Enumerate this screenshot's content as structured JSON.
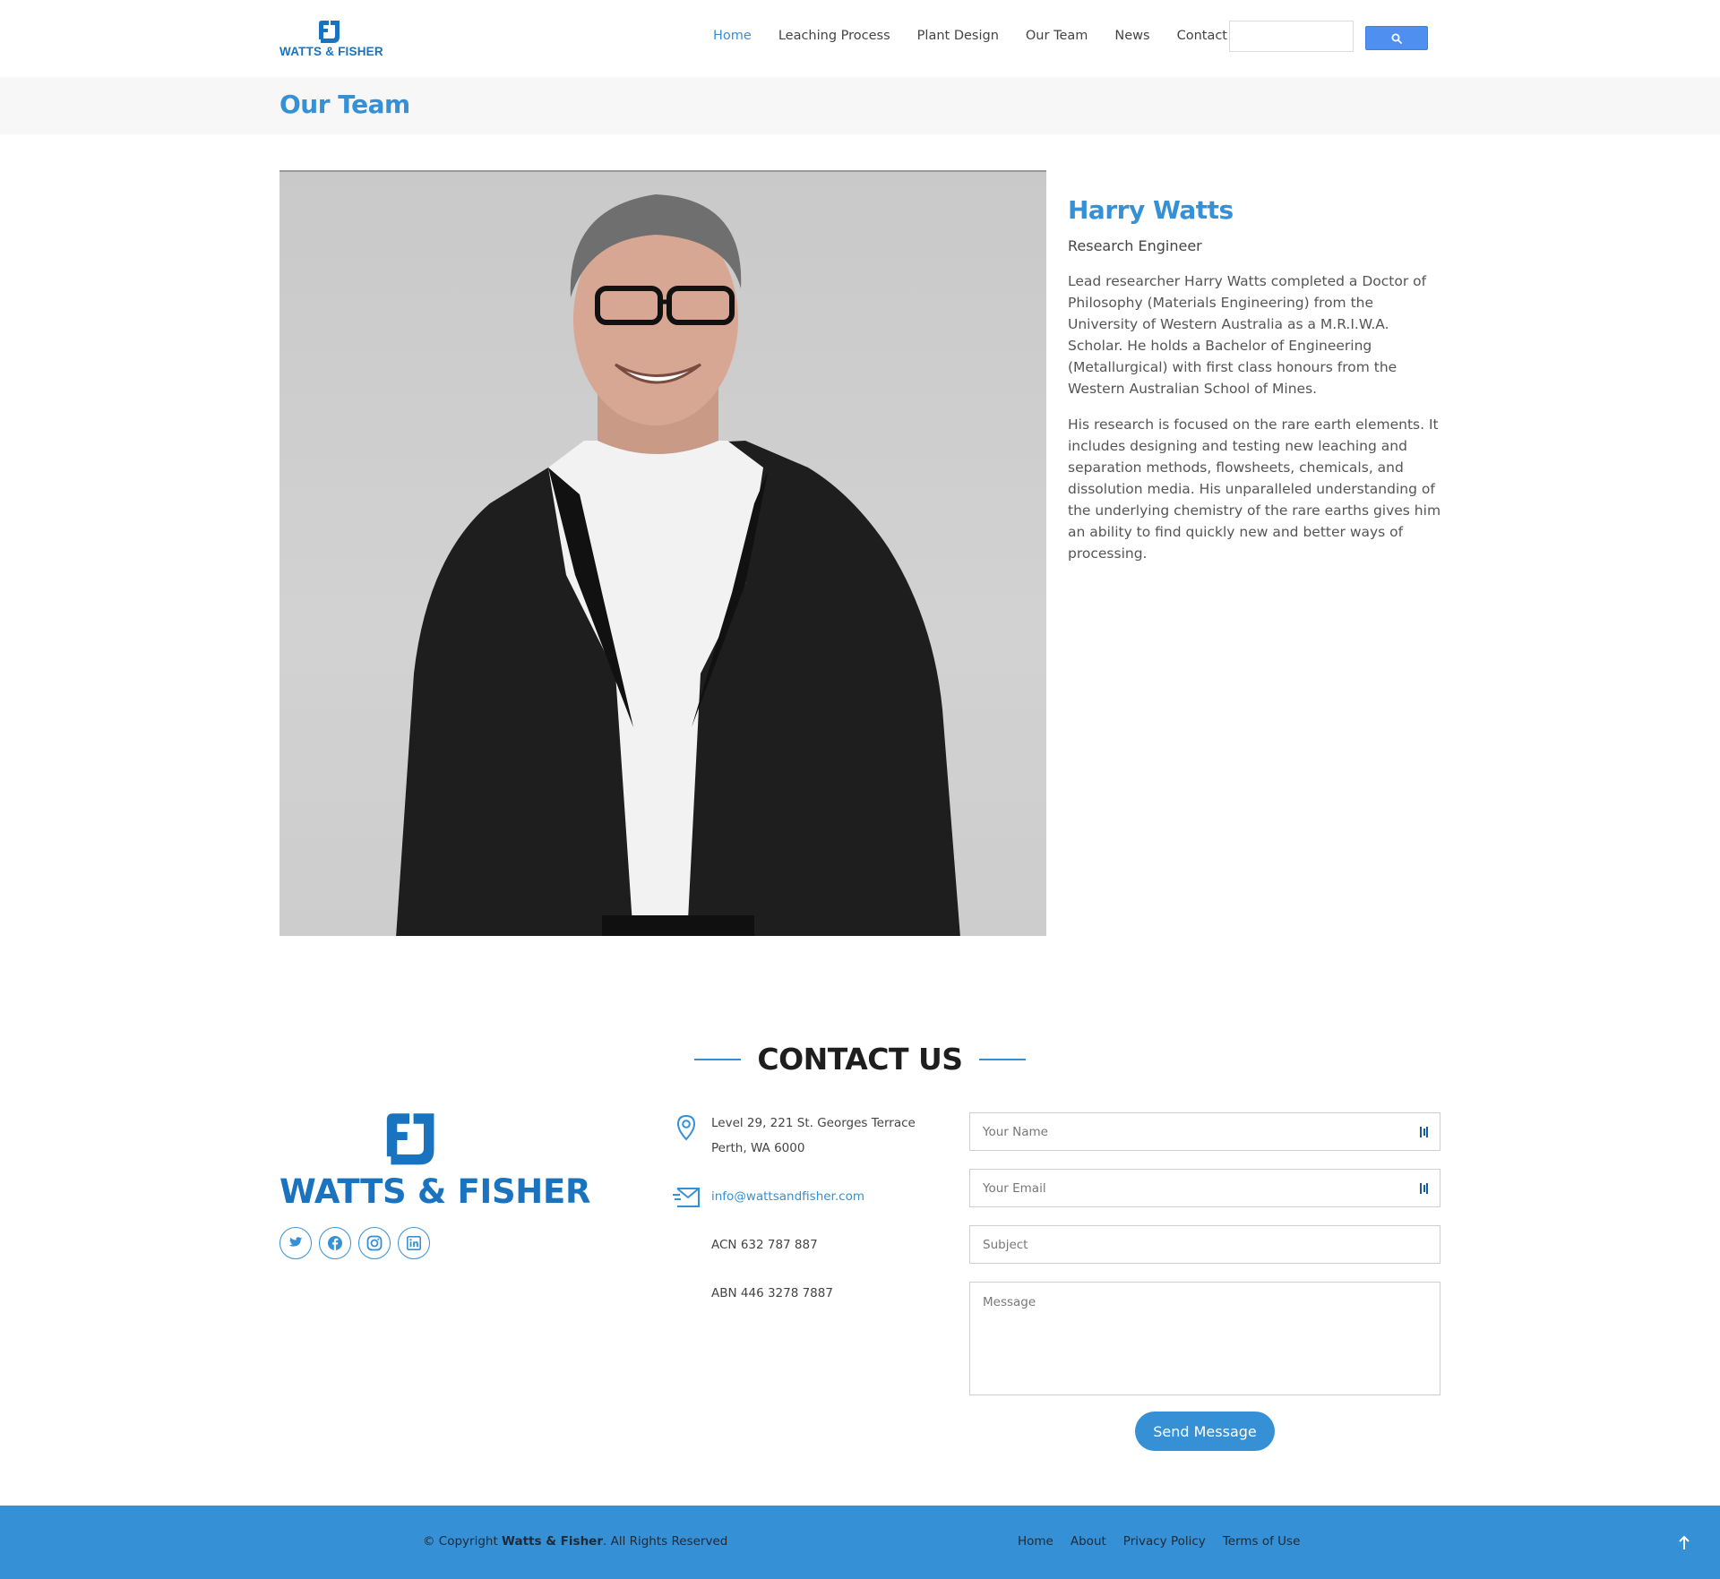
{
  "brand": {
    "name": "WATTS & FISHER",
    "accent_color": "#3690d6",
    "logo_color": "#1a73be"
  },
  "nav": {
    "items": [
      {
        "label": "Home",
        "active": true
      },
      {
        "label": "Leaching Process",
        "active": false
      },
      {
        "label": "Plant Design",
        "active": false
      },
      {
        "label": "Our Team",
        "active": false
      },
      {
        "label": "News",
        "active": false
      },
      {
        "label": "Contact",
        "active": false
      }
    ],
    "search_icon": "search-icon"
  },
  "page_title": "Our Team",
  "profile": {
    "name": "Harry Watts",
    "role": "Research Engineer",
    "bio": [
      "Lead researcher Harry Watts completed a Doctor of Philosophy (Materials Engineering) from the University of Western Australia as a M.R.I.W.A. Scholar. He holds a Bachelor of Engineering (Metallurgical) with first class honours from the Western Australian School of Mines.",
      "His research is focused on the rare earth elements. It includes designing and testing new leaching and separation methods, flowsheets, chemicals, and dissolution media. His unparalleled understanding of the underlying chemistry of the rare earths gives him an ability to find quickly new and better ways of processing."
    ]
  },
  "contact": {
    "heading": "CONTACT US",
    "address_line1": "Level 29, 221 St. Georges Terrace",
    "address_line2": "Perth, WA 6000",
    "email": "info@wattsandfisher.com",
    "acn": "ACN 632 787 887",
    "abn": "ABN 446 3278 7887",
    "socials": [
      "twitter-icon",
      "facebook-icon",
      "instagram-icon",
      "linkedin-icon"
    ]
  },
  "form": {
    "name_placeholder": "Your Name",
    "email_placeholder": "Your Email",
    "subject_placeholder": "Subject",
    "message_placeholder": "Message",
    "submit_label": "Send Message"
  },
  "footer": {
    "copy_prefix": "© Copyright ",
    "copy_brand": "Watts & Fisher",
    "copy_suffix": ". All Rights Reserved",
    "links": [
      "Home",
      "About",
      "Privacy Policy",
      "Terms of Use"
    ]
  }
}
